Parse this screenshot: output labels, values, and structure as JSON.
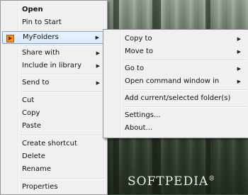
{
  "watermark": "SOFTPEDIA",
  "watermark_mark": "®",
  "context_menu": {
    "items": [
      {
        "label": "Open"
      },
      {
        "label": "Pin to Start"
      },
      {
        "label": "MyFolders",
        "icon": "myfolders-icon"
      },
      {
        "label": "Share with"
      },
      {
        "label": "Include in library"
      },
      {
        "label": "Send to"
      },
      {
        "label": "Cut"
      },
      {
        "label": "Copy"
      },
      {
        "label": "Paste"
      },
      {
        "label": "Create shortcut"
      },
      {
        "label": "Delete"
      },
      {
        "label": "Rename"
      },
      {
        "label": "Properties"
      }
    ],
    "arrow_glyph": "▶"
  },
  "submenu": {
    "items": [
      {
        "label": "Copy to"
      },
      {
        "label": "Move to"
      },
      {
        "label": "Go to"
      },
      {
        "label": "Open command window in"
      },
      {
        "label": "Add current/selected folder(s)"
      },
      {
        "label": "Settings..."
      },
      {
        "label": "About..."
      }
    ]
  }
}
